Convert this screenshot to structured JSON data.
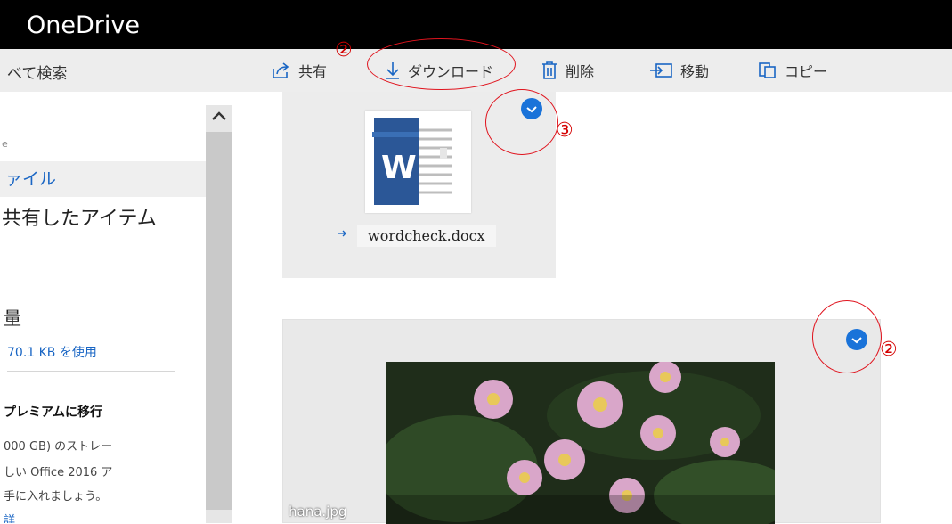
{
  "app": {
    "title": "OneDrive"
  },
  "search": {
    "text": "べて検索"
  },
  "toolbar": {
    "share_label": "共有",
    "download_label": "ダウンロード",
    "delete_label": "削除",
    "move_label": "移動",
    "copy_label": "コピー"
  },
  "sidebar": {
    "small_label": "e",
    "files_label": "ァイル",
    "shared_label": "共有したアイテム",
    "heading": "量",
    "usage_text": "70.1 KB を使用",
    "premium_label": "プレミアムに移行",
    "promo_lines": [
      "000 GB) のストレー",
      "しい Office 2016 ア",
      "手に入れましょう。"
    ],
    "link_text": "詳"
  },
  "files": [
    {
      "name": "wordcheck.docx",
      "type": "docx",
      "selected": true
    },
    {
      "name": "hana.jpg",
      "type": "jpg",
      "selected": true
    }
  ],
  "annotations": {
    "download_marker": "②",
    "doc_marker": "③",
    "photo_marker": "②"
  },
  "colors": {
    "accent": "#1a73d9",
    "annotation": "#e0141e",
    "titlebar": "#000000",
    "commandbar": "#ededed"
  }
}
